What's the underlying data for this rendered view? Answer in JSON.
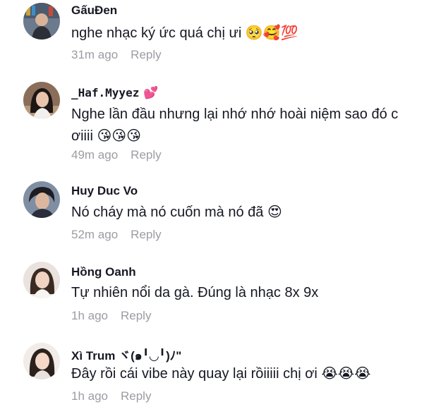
{
  "comments": [
    {
      "username": "GấuĐen",
      "text": "nghe nhạc ký ức quá chị ưi",
      "emojis": "🥺🥰💯",
      "time": "31m ago",
      "reply_label": "Reply"
    },
    {
      "username": "_Haf.Myyez",
      "username_emoji": "💕",
      "text": "Nghe lần đầu nhưng lại nhớ nhớ hoài niệm sao đó c ơiiii",
      "emojis": "😘😘😘",
      "time": "49m ago",
      "reply_label": "Reply"
    },
    {
      "username": "Huy Duc Vo",
      "text": "Nó cháy mà nó cuốn mà nó đã",
      "emojis": "😍",
      "time": "52m ago",
      "reply_label": "Reply"
    },
    {
      "username": "Hồng Oanh",
      "text": "Tự nhiên nổi da gà. Đúng là nhạc 8x 9x",
      "emojis": "",
      "time": "1h ago",
      "reply_label": "Reply"
    },
    {
      "username": "Xì Trum ヾ(๑╹◡╹)ﾉ\"",
      "text": "Đây rồi cái vibe này quay lại rồiiiii chị ơi",
      "emojis": "😭😭😭",
      "time": "1h ago",
      "reply_label": "Reply"
    }
  ],
  "colors": {
    "username": "#161823",
    "text": "#161823",
    "meta": "#9b9ca3",
    "background": "#ffffff"
  }
}
